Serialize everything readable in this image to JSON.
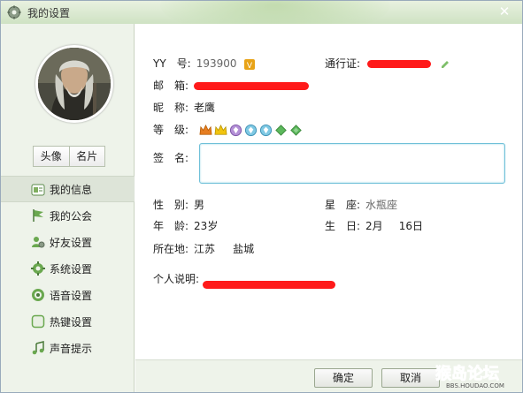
{
  "window": {
    "title": "我的设置"
  },
  "sidebar": {
    "avatar_button": "头像",
    "card_button": "名片",
    "items": [
      {
        "label": "我的信息",
        "icon": "id-card-icon",
        "active": true
      },
      {
        "label": "我的公会",
        "icon": "flag-icon",
        "active": false
      },
      {
        "label": "好友设置",
        "icon": "friends-gear-icon",
        "active": false
      },
      {
        "label": "系统设置",
        "icon": "gear-icon",
        "active": false
      },
      {
        "label": "语音设置",
        "icon": "headset-icon",
        "active": false
      },
      {
        "label": "热键设置",
        "icon": "hotkey-icon",
        "active": false
      },
      {
        "label": "声音提示",
        "icon": "music-note-icon",
        "active": false
      }
    ]
  },
  "profile": {
    "yy_label": "YY　号:",
    "yy_value": "193900",
    "passport_label": "通行证:",
    "email_label": "邮　箱:",
    "nickname_label": "昵　称:",
    "nickname_value": "老鹰",
    "level_label": "等　级:",
    "level_icons": [
      "crown-icon",
      "crown-icon",
      "diamond-icon",
      "diamond-icon",
      "diamond-icon",
      "leaf-icon",
      "leaf-icon"
    ],
    "signature_label": "签　名:",
    "signature_value": "",
    "gender_label": "性　别:",
    "gender_value": "男",
    "zodiac_label": "星　座:",
    "zodiac_value": "水瓶座",
    "age_label": "年　龄:",
    "age_value": "23岁",
    "birthday_label": "生　日:",
    "birthday_month": "2月",
    "birthday_day": "16日",
    "location_label": "所在地:",
    "location_province": "江苏",
    "location_city": "盐城",
    "bio_label": "个人说明:"
  },
  "footer": {
    "ok_label": "确定",
    "cancel_label": "取消"
  },
  "watermark": {
    "text": "猴岛论坛",
    "url": "BBS.HOUDAO.COM"
  },
  "colors": {
    "accent": "#6fc0d8",
    "redaction": "#ff1a1a",
    "sidebar_bg": "#eef3ea"
  }
}
